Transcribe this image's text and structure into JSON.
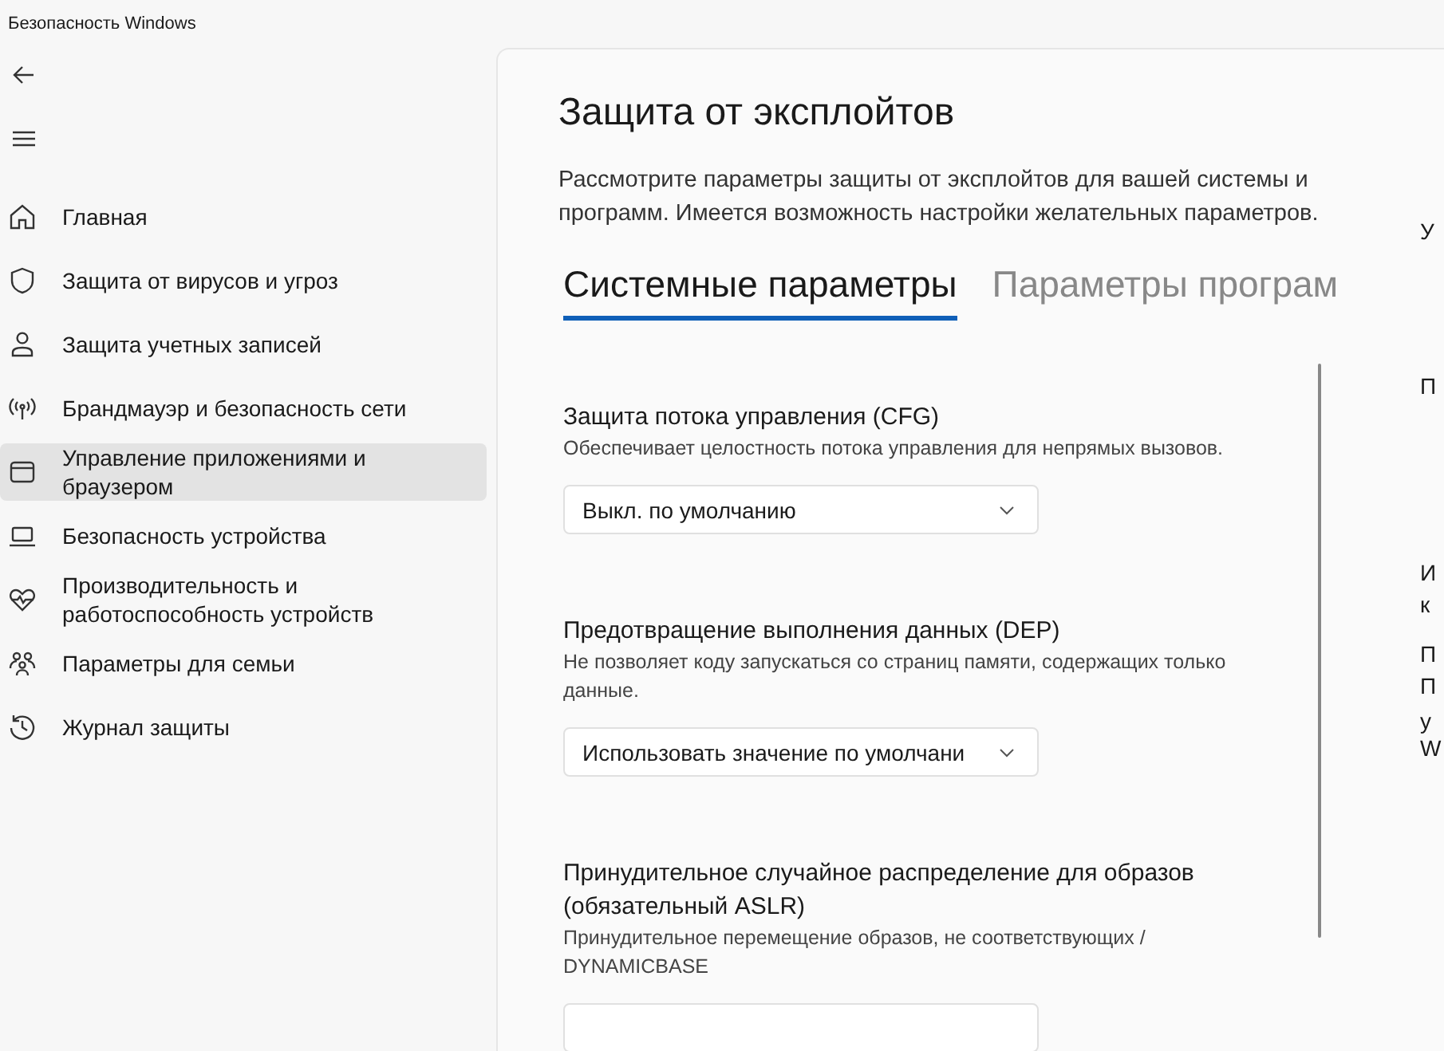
{
  "window": {
    "title": "Безопасность Windows"
  },
  "sidebar": {
    "items": [
      {
        "label": "Главная",
        "selected": false
      },
      {
        "label": "Защита от вирусов и угроз",
        "selected": false
      },
      {
        "label": "Защита учетных записей",
        "selected": false
      },
      {
        "label": "Брандмауэр и безопасность сети",
        "selected": false
      },
      {
        "label": "Управление приложениями и браузером",
        "selected": true
      },
      {
        "label": "Безопасность устройства",
        "selected": false
      },
      {
        "label": "Производительность и работоспособность устройств",
        "selected": false
      },
      {
        "label": "Параметры для семьи",
        "selected": false
      },
      {
        "label": "Журнал защиты",
        "selected": false
      }
    ]
  },
  "page": {
    "title": "Защита от эксплойтов",
    "description": "Рассмотрите параметры защиты от эксплойтов для вашей системы и программ. Имеется возможность настройки желательных параметров.",
    "tabs": [
      {
        "label": "Системные параметры",
        "selected": true
      },
      {
        "label": "Параметры програм",
        "selected": false
      }
    ],
    "settings": [
      {
        "title": "Защита потока управления (CFG)",
        "description": "Обеспечивает целостность потока управления для непрямых вызовов.",
        "value": "Выкл. по умолчанию"
      },
      {
        "title": "Предотвращение выполнения данных (DEP)",
        "description": "Не позволяет коду запускаться со страниц памяти, содержащих только данные.",
        "value": "Использовать значение по умолчани"
      },
      {
        "title": "Принудительное случайное распределение для образов (обязательный ASLR)",
        "description": "Принудительное перемещение образов, не соответствующих / DYNAMICBASE"
      }
    ]
  },
  "side_column": {
    "lines": [
      "У",
      "П",
      "И",
      "к",
      "П",
      "П",
      "у",
      "W"
    ]
  }
}
